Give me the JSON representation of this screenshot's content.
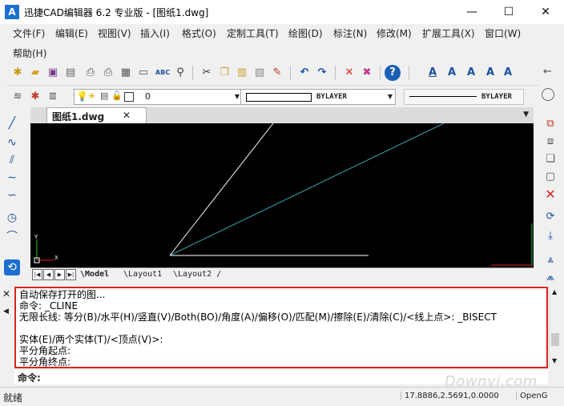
{
  "window": {
    "title": "迅捷CAD编辑器 6.2 专业版  - [图纸1.dwg]",
    "logo_text": "A",
    "minimize": "—",
    "maximize": "☐",
    "close": "✕"
  },
  "menu": {
    "row1": [
      "文件(F)",
      "编辑(E)",
      "视图(V)",
      "插入(I)",
      "格式(O)",
      "定制工具(T)",
      "绘图(D)",
      "标注(N)",
      "修改(M)",
      "扩展工具(X)",
      "窗口(W)"
    ],
    "row2": [
      "帮助(H)"
    ]
  },
  "toolbar2": {
    "layer_value": "0",
    "linetype_value": "BYLAYER",
    "lineweight_value": "BYLAYER"
  },
  "document": {
    "tab_label": "图纸1.dwg",
    "tab_close": "✕",
    "ucs_x": "X",
    "ucs_y": "Y"
  },
  "layout_tabs": [
    "Model",
    "Layout1",
    "Layout2"
  ],
  "command": {
    "lines": [
      "自动保存打开的图...",
      "命令: _CLINE",
      "无限长线: 等分(B)/水平(H)/竖直(V)/Both(BO)/角度(A)/偏移(O)/匹配(M)/擦除(E)/清除(C)/<线上点>: _BISECT",
      "实体(E)/两个实体(T)/<顶点(V)>:",
      "平分角起点:",
      "平分角终点:"
    ],
    "prompt": "命令:"
  },
  "status": {
    "ready": "就绪",
    "coords": "17.8886,2.5691,0.0000",
    "renderer": "OpenG"
  },
  "watermark": "Downyi.com",
  "colors": {
    "canvas_bg": "#000000",
    "white_line": "#ffffff",
    "cyan_line": "#3aa6b3",
    "highlight_border": "#d9241c"
  }
}
